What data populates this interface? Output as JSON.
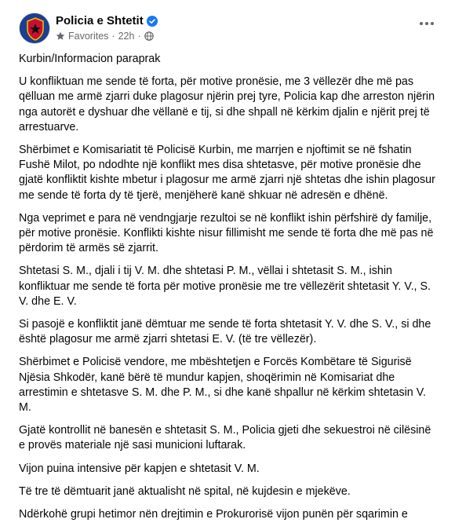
{
  "header": {
    "page_name": "Policia e Shtetit",
    "audience": "Favorites",
    "time": "22h",
    "dot": "·"
  },
  "colors": {
    "verified": "#1877f2",
    "avatar_bg": "#1c3f8f",
    "meta_text": "#65676b"
  },
  "icons": [
    "police-badge-avatar",
    "verified-badge-icon",
    "star-icon",
    "globe-icon",
    "more-options-icon"
  ],
  "post": {
    "paragraphs": [
      "Kurbin/Informacion paraprak",
      "U konfliktuan me sende të forta, për motive pronësie, me 3 vëllezër dhe më pas qëlluan me armë zjarri duke plagosur njërin prej tyre, Policia kap dhe arreston njërin nga autorët e dyshuar dhe vëllanë e tij, si dhe shpall në kërkim djalin e njërit prej të arrestuarve.",
      "Shërbimet e Komisariatit të Policisë Kurbin, me marrjen e njoftimit se në fshatin Fushë Milot, po ndodhte një konflikt mes disa shtetasve, për motive pronësie dhe gjatë konfliktit kishte mbetur i plagosur me armë zjarri një shtetas dhe ishin plagosur me sende të forta dy të tjerë, menjëherë kanë shkuar në adresën e dhënë.",
      "Nga veprimet e para në vendngjarje rezultoi se në konflikt ishin përfshirë dy familje, për motive pronësie. Konflikti kishte nisur fillimisht me sende të forta dhe më pas në përdorim të armës së zjarrit.",
      "Shtetasi S. M., djali i tij V. M. dhe shtetasi P. M., vëllai i shtetasit S. M., ishin konfliktuar me sende të forta për motive pronësie me tre vëllezërit shtetasit Y. V., S. V. dhe E. V.",
      "Si pasojë e konfliktit janë dëmtuar me sende të forta shtetasit Y. V. dhe S. V., si dhe është plagosur me armë zjarri shtetasi E. V. (të tre vëllezër).",
      "Shërbimet e Policisë vendore, me mbështetjen e Forcës Kombëtare të Sigurisë Njësia Shkodër, kanë bërë të mundur kapjen, shoqërimin në Komisariat dhe arrestimin e shtetasve S. M. dhe P. M., si dhe kanë shpallur në kërkim shtetasin V. M.",
      "Gjatë kontrollit në banesën e shtetasit S. M., Policia gjeti dhe sekuestroi në cilësinë e provës materiale një sasi municioni luftarak.",
      "Vijon puina intensive për kapjen e shtetasit V. M.",
      "Të tre të dëmtuarit janë aktualisht në spital, në kujdesin e mjekëve.",
      "Ndërkohë grupi hetimor nën drejtimin e Prokurorisë vijon punën për sqarimin e"
    ]
  }
}
